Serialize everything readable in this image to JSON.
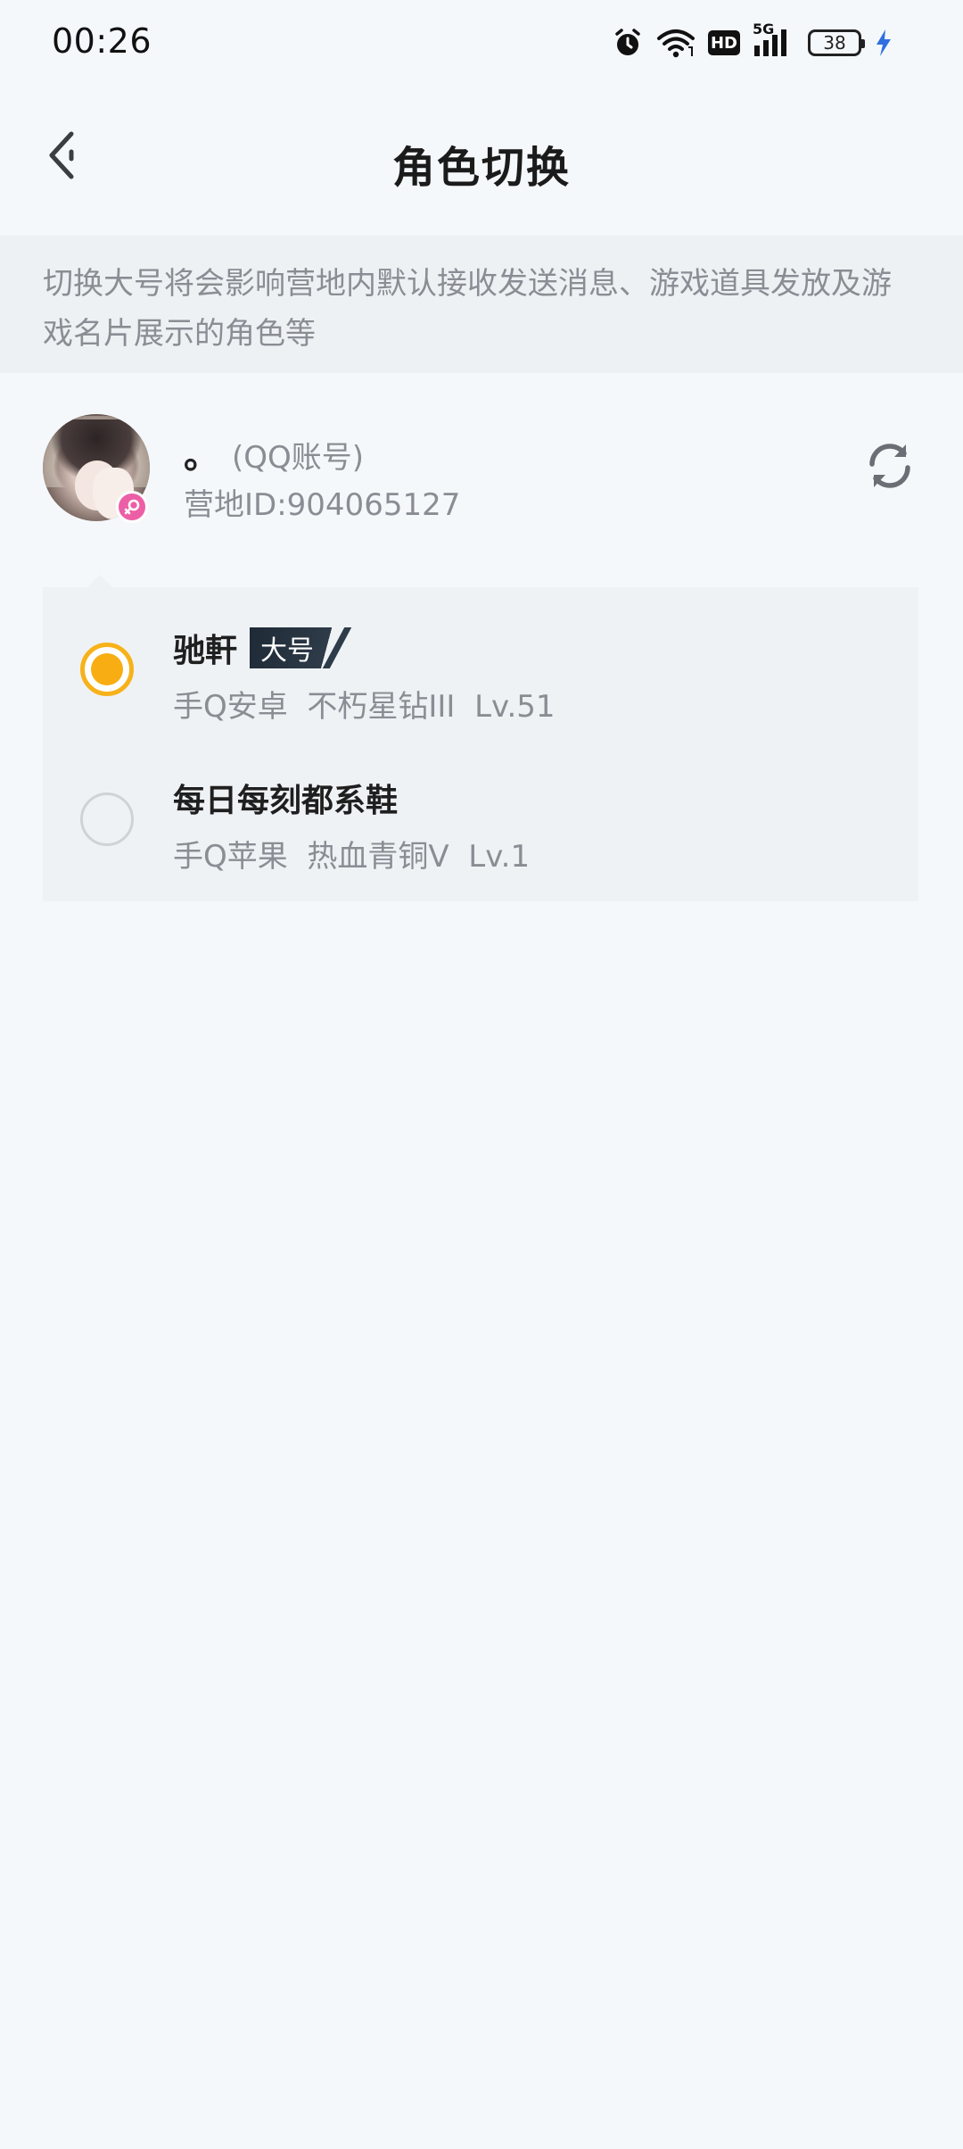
{
  "status_bar": {
    "time": "00:26",
    "network": "5G",
    "hd": "HD",
    "battery": "38",
    "icons": [
      "alarm-icon",
      "wifi-icon",
      "hd-icon",
      "signal-icon",
      "battery-icon",
      "charging-icon"
    ]
  },
  "nav": {
    "title": "角色切换",
    "back_icon": "chevron-left-icon"
  },
  "notice": {
    "text": "切换大号将会影响营地内默认接收发送消息、游戏道具发放及游戏名片展示的角色等"
  },
  "account": {
    "name": "。",
    "type": "(QQ账号)",
    "id_text": "营地ID:904065127",
    "gender": "female",
    "refresh_icon": "refresh-icon"
  },
  "roles": [
    {
      "name": "驰軒",
      "badge": "大号",
      "detail": "手Q安卓  不朽星钻III  Lv.51",
      "selected": true
    },
    {
      "name": "每日每刻都系鞋",
      "badge": "",
      "detail": "手Q苹果  热血青铜V  Lv.1",
      "selected": false
    }
  ],
  "colors": {
    "accent": "#f8ad12",
    "background": "#f5f8fb",
    "notice_bg": "#eef1f4",
    "panel_bg": "#eff2f5",
    "secondary_text": "#8a8e94",
    "gender_badge": "#ec5fa6",
    "charging": "#2f6fe0"
  }
}
